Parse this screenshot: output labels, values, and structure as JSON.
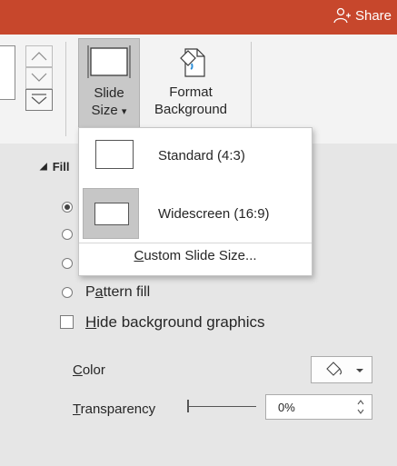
{
  "titlebar": {
    "share_label": "Share",
    "share_icon": "person-add-icon",
    "color": "#c7472c"
  },
  "ribbon": {
    "slide_size": {
      "line1": "Slide",
      "line2": "Size",
      "dropdown_glyph": "▾",
      "icon": "slide-size-icon"
    },
    "format_background": {
      "line1": "Format",
      "line2": "Background",
      "icon": "format-background-icon"
    }
  },
  "panel": {
    "fill_section": {
      "label": "Fill"
    },
    "pattern_fill": {
      "label_pre": "P",
      "accel": "a",
      "label_post": "ttern fill"
    },
    "hide_background": {
      "accel": "H",
      "label_post": "ide background graphics"
    },
    "color": {
      "accel": "C",
      "label_post": "olor",
      "icon": "paint-bucket-icon"
    },
    "transparency": {
      "accel": "T",
      "label_post": "ransparency",
      "value": "0%"
    }
  },
  "slide_size_menu": {
    "items": [
      {
        "label": "Standard (4:3)",
        "selected": false
      },
      {
        "label": "Widescreen (16:9)",
        "selected": true
      }
    ],
    "custom": {
      "accel": "C",
      "label_post": "ustom Slide Size..."
    }
  }
}
